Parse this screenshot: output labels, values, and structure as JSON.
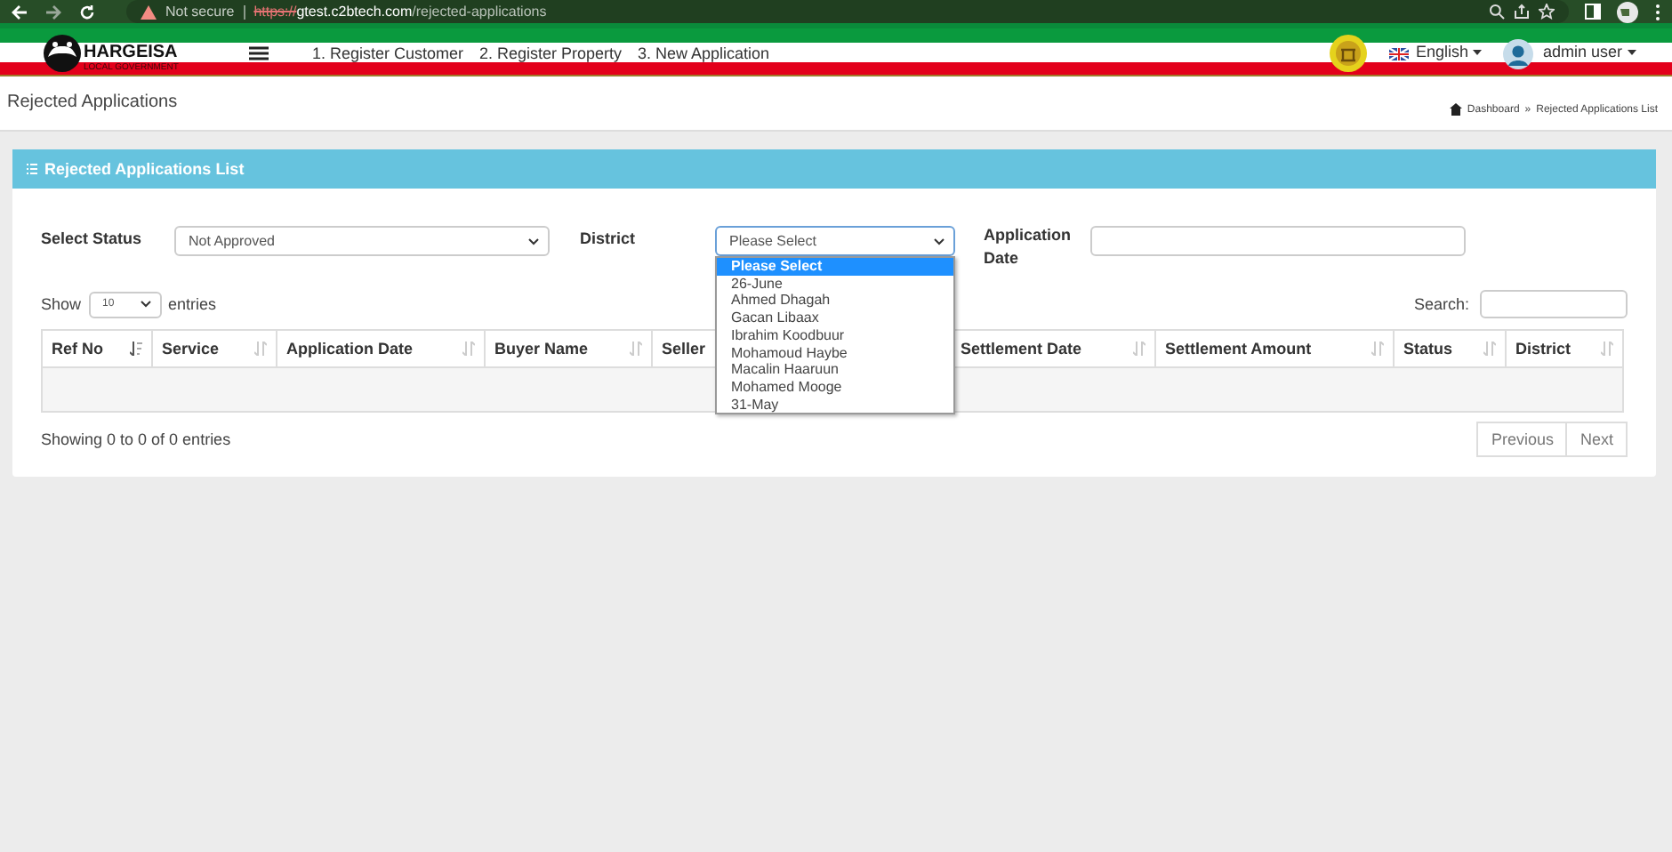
{
  "browser": {
    "security": "Not secure",
    "url_scheme": "https://",
    "url_host": "gtest.c2btech.com",
    "url_path": "/rejected-applications"
  },
  "header": {
    "logo_title": "HARGEISA",
    "logo_subtitle": "LOCAL GOVERNMENT",
    "nav": [
      "1. Register Customer",
      "2. Register Property",
      "3. New Application"
    ],
    "language": "English",
    "user": "admin user"
  },
  "page": {
    "title": "Rejected Applications",
    "breadcrumb": [
      "Dashboard",
      "»",
      "Rejected Applications List"
    ]
  },
  "panel": {
    "title": "Rejected Applications List",
    "filters": {
      "status_label": "Select Status",
      "status_value": "Not Approved",
      "district_label": "District",
      "district_value": "Please Select",
      "date_label": "Application Date",
      "district_options": [
        {
          "label": "Please Select",
          "selected": true
        },
        {
          "label": "26-June",
          "selected": false
        },
        {
          "label": "Ahmed Dhagah",
          "selected": false
        },
        {
          "label": "Gacan Libaax",
          "selected": false
        },
        {
          "label": "Ibrahim Koodbuur",
          "selected": false
        },
        {
          "label": "Mohamoud Haybe",
          "selected": false
        },
        {
          "label": "Macalin Haaruun",
          "selected": false
        },
        {
          "label": "Mohamed Mooge",
          "selected": false
        },
        {
          "label": "31-May",
          "selected": false
        }
      ]
    },
    "length": {
      "show": "Show",
      "value": "10",
      "entries": "entries"
    },
    "search_label": "Search:",
    "table": {
      "columns": [
        {
          "label": "Ref No",
          "sorted": true
        },
        {
          "label": "Service",
          "sorted": false
        },
        {
          "label": "Application Date",
          "sorted": false
        },
        {
          "label": "Buyer Name",
          "sorted": false
        },
        {
          "label": "Seller"
        },
        {
          "label": "Settlement Date",
          "sorted": false
        },
        {
          "label": "Settlement Amount",
          "sorted": false
        },
        {
          "label": "Status",
          "sorted": false
        },
        {
          "label": "District",
          "sorted": false
        }
      ]
    },
    "info": "Showing 0 to 0 of 0 entries",
    "pagination": [
      "Previous",
      "Next"
    ]
  }
}
